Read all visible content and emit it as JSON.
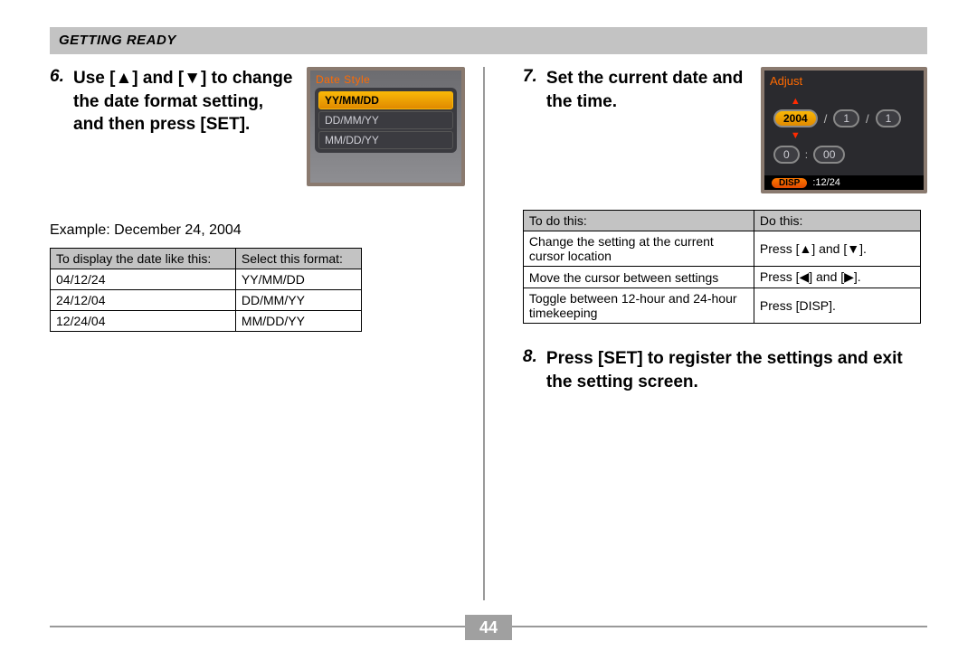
{
  "header": "Getting Ready",
  "pageNumber": "44",
  "step6": {
    "num": "6.",
    "text": "Use [▲] and [▼] to change the date format setting, and then press [SET].",
    "lcd_title": "Date Style",
    "options": [
      "YY/MM/DD",
      "DD/MM/YY",
      "MM/DD/YY"
    ],
    "example": "Example: December 24, 2004",
    "table": {
      "h1": "To display the date like this:",
      "h2": "Select this format:",
      "rows": [
        {
          "c1": "04/12/24",
          "c2": "YY/MM/DD"
        },
        {
          "c1": "24/12/04",
          "c2": "DD/MM/YY"
        },
        {
          "c1": "12/24/04",
          "c2": "MM/DD/YY"
        }
      ]
    }
  },
  "step7": {
    "num": "7.",
    "text": "Set the current date and the time.",
    "lcd_title": "Adjust",
    "year": "2004",
    "month": "1",
    "day": "1",
    "hour": "0",
    "minute": "00",
    "sep_slash": "/",
    "sep_colon": ":",
    "footer_label": "DISP",
    "footer_value": ":12/24",
    "table": {
      "h1": "To do this:",
      "h2": "Do this:",
      "rows": [
        {
          "c1": "Change the setting at the current cursor location",
          "c2": "Press [▲] and [▼]."
        },
        {
          "c1": "Move the cursor between settings",
          "c2": "Press [◀] and [▶]."
        },
        {
          "c1": "Toggle between 12-hour and 24-hour timekeeping",
          "c2": "Press [DISP]."
        }
      ]
    }
  },
  "step8": {
    "num": "8.",
    "text": "Press [SET] to register the settings and exit the setting screen."
  }
}
